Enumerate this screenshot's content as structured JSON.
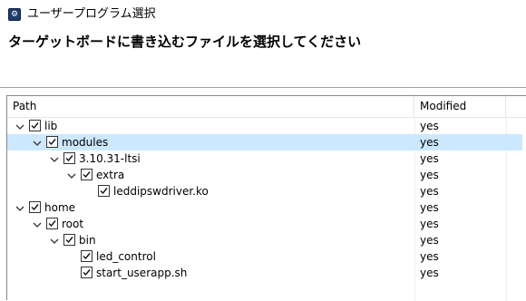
{
  "window": {
    "title": "ユーザープログラム選択",
    "icon": "app-gear-icon"
  },
  "heading": "ターゲットボードに書き込むファイルを選択してください",
  "tree": {
    "columns": [
      "Path",
      "Modified"
    ],
    "rows": [
      {
        "label": "lib",
        "level": 0,
        "expanded": true,
        "checked": true,
        "modified": "yes",
        "selected": false
      },
      {
        "label": "modules",
        "level": 1,
        "expanded": true,
        "checked": true,
        "modified": "yes",
        "selected": true
      },
      {
        "label": "3.10.31-ltsi",
        "level": 2,
        "expanded": true,
        "checked": true,
        "modified": "yes",
        "selected": false
      },
      {
        "label": "extra",
        "level": 3,
        "expanded": true,
        "checked": true,
        "modified": "yes",
        "selected": false
      },
      {
        "label": "leddipswdriver.ko",
        "level": 4,
        "expanded": null,
        "checked": true,
        "modified": "yes",
        "selected": false
      },
      {
        "label": "home",
        "level": 0,
        "expanded": true,
        "checked": true,
        "modified": "yes",
        "selected": false
      },
      {
        "label": "root",
        "level": 1,
        "expanded": true,
        "checked": true,
        "modified": "yes",
        "selected": false
      },
      {
        "label": "bin",
        "level": 2,
        "expanded": true,
        "checked": true,
        "modified": "yes",
        "selected": false
      },
      {
        "label": "led_control",
        "level": 3,
        "expanded": null,
        "checked": true,
        "modified": "yes",
        "selected": false
      },
      {
        "label": "start_userapp.sh",
        "level": 3,
        "expanded": null,
        "checked": true,
        "modified": "yes",
        "selected": false
      }
    ]
  },
  "colors": {
    "selection": "#cce8ff",
    "border": "#828790"
  }
}
